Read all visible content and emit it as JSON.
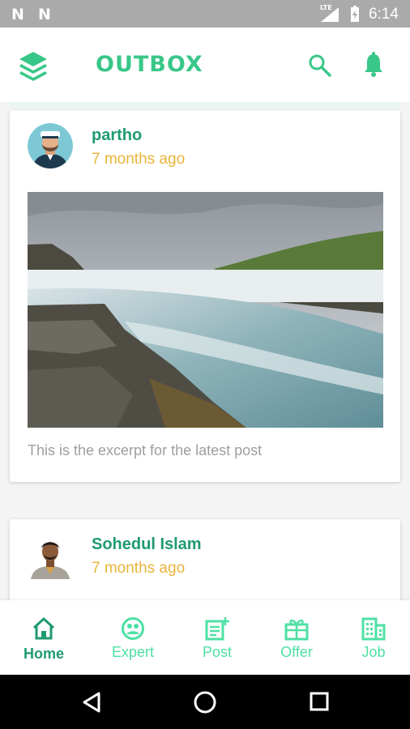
{
  "status_bar": {
    "time": "6:14",
    "network": "LTE"
  },
  "app_bar": {
    "title": "OUTBOX",
    "menu_icon": "layers-icon",
    "search_icon": "search-icon",
    "notification_icon": "bell-icon"
  },
  "posts": [
    {
      "author": "partho",
      "time": "7 months ago",
      "excerpt": "This is the excerpt for the latest post",
      "image": "waterfall-landscape"
    },
    {
      "author": "Sohedul Islam",
      "time": "7 months ago"
    }
  ],
  "bottom_nav": {
    "items": [
      {
        "label": "Home",
        "icon": "home-icon",
        "active": true
      },
      {
        "label": "Expert",
        "icon": "expert-icon",
        "active": false
      },
      {
        "label": "Post",
        "icon": "post-add-icon",
        "active": false
      },
      {
        "label": "Offer",
        "icon": "gift-icon",
        "active": false
      },
      {
        "label": "Job",
        "icon": "building-icon",
        "active": false
      }
    ]
  },
  "colors": {
    "accent": "#39c788",
    "dark_green": "#1f9a72",
    "time_yellow": "#e8b53a",
    "nav_green": "#4ee0a3"
  }
}
